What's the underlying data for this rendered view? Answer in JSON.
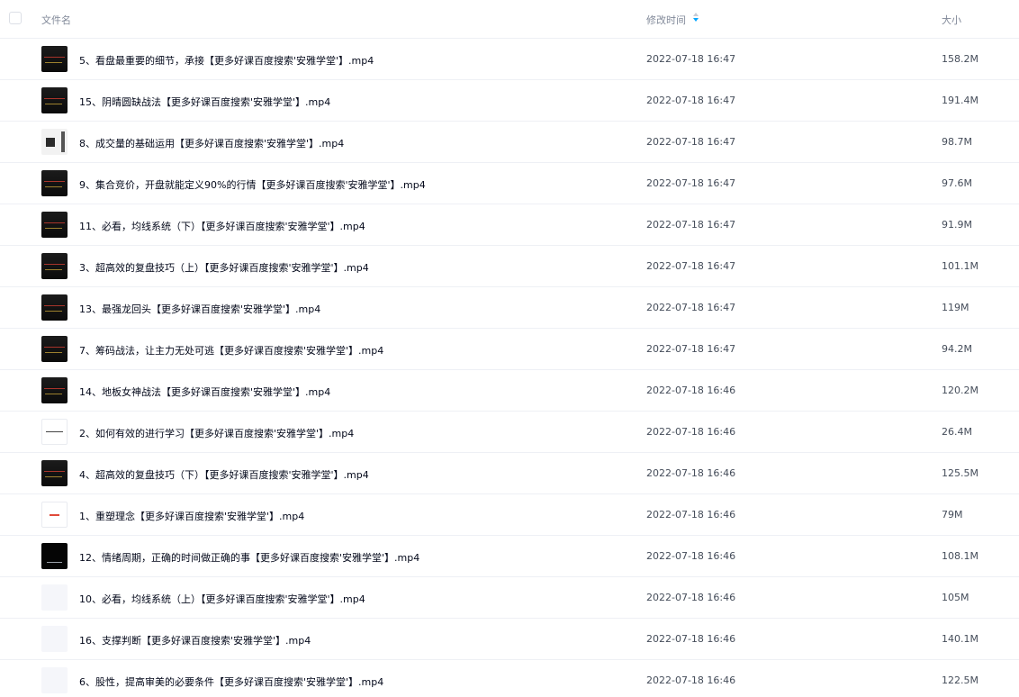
{
  "header": {
    "name_label": "文件名",
    "time_label": "修改时间",
    "size_label": "大小",
    "sort_icon": "sort-icon",
    "sort_color": "#06a7ff"
  },
  "files": [
    {
      "name": "5、看盘最重要的细节，承接【更多好课百度搜索'安雅学堂'】.mp4",
      "time": "2022-07-18 16:47",
      "size": "158.2M",
      "thumb": "dark"
    },
    {
      "name": "15、阴晴圆缺战法【更多好课百度搜索'安雅学堂'】.mp4",
      "time": "2022-07-18 16:47",
      "size": "191.4M",
      "thumb": "dark"
    },
    {
      "name": "8、成交量的基础运用【更多好课百度搜索'安雅学堂'】.mp4",
      "time": "2022-07-18 16:47",
      "size": "98.7M",
      "thumb": "gray"
    },
    {
      "name": "9、集合竞价，开盘就能定义90%的行情【更多好课百度搜索'安雅学堂'】.mp4",
      "time": "2022-07-18 16:47",
      "size": "97.6M",
      "thumb": "dark"
    },
    {
      "name": "11、必看，均线系统（下）【更多好课百度搜索'安雅学堂'】.mp4",
      "time": "2022-07-18 16:47",
      "size": "91.9M",
      "thumb": "dark"
    },
    {
      "name": "3、超高效的复盘技巧（上）【更多好课百度搜索'安雅学堂'】.mp4",
      "time": "2022-07-18 16:47",
      "size": "101.1M",
      "thumb": "dark"
    },
    {
      "name": "13、最强龙回头【更多好课百度搜索'安雅学堂'】.mp4",
      "time": "2022-07-18 16:47",
      "size": "119M",
      "thumb": "dark"
    },
    {
      "name": "7、筹码战法，让主力无处可逃【更多好课百度搜索'安雅学堂'】.mp4",
      "time": "2022-07-18 16:47",
      "size": "94.2M",
      "thumb": "dark"
    },
    {
      "name": "14、地板女神战法【更多好课百度搜索'安雅学堂'】.mp4",
      "time": "2022-07-18 16:46",
      "size": "120.2M",
      "thumb": "dark"
    },
    {
      "name": "2、如何有效的进行学习【更多好课百度搜索'安雅学堂'】.mp4",
      "time": "2022-07-18 16:46",
      "size": "26.4M",
      "thumb": "whitebar"
    },
    {
      "name": "4、超高效的复盘技巧（下）【更多好课百度搜索'安雅学堂'】.mp4",
      "time": "2022-07-18 16:46",
      "size": "125.5M",
      "thumb": "dark"
    },
    {
      "name": "1、重塑理念【更多好课百度搜索'安雅学堂'】.mp4",
      "time": "2022-07-18 16:46",
      "size": "79M",
      "thumb": "whitered"
    },
    {
      "name": "12、情绪周期，正确的时间做正确的事【更多好课百度搜索'安雅学堂'】.mp4",
      "time": "2022-07-18 16:46",
      "size": "108.1M",
      "thumb": "black"
    },
    {
      "name": "10、必看，均线系统（上）【更多好课百度搜索'安雅学堂'】.mp4",
      "time": "2022-07-18 16:46",
      "size": "105M",
      "thumb": "blank"
    },
    {
      "name": "16、支撑判断【更多好课百度搜索'安雅学堂'】.mp4",
      "time": "2022-07-18 16:46",
      "size": "140.1M",
      "thumb": "blank"
    },
    {
      "name": "6、股性，提高审美的必要条件【更多好课百度搜索'安雅学堂'】.mp4",
      "time": "2022-07-18 16:46",
      "size": "122.5M",
      "thumb": "blank"
    }
  ]
}
